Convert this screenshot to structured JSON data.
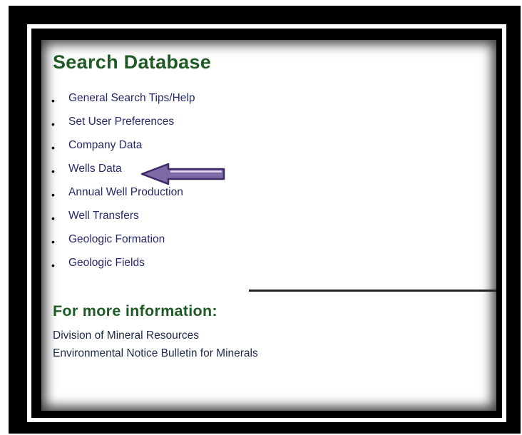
{
  "colors": {
    "heading": "#1e5b24",
    "link": "#26296a",
    "info_link": "#1f2a4a",
    "arrow_fill": "#7e6aa6",
    "arrow_stroke": "#3c2a66",
    "divider": "#222222"
  },
  "search": {
    "title": "Search Database",
    "items": [
      {
        "label": "General Search Tips/Help"
      },
      {
        "label": "Set User Preferences"
      },
      {
        "label": "Company Data"
      },
      {
        "label": "Wells Data"
      },
      {
        "label": "Annual Well Production"
      },
      {
        "label": "Well Transfers"
      },
      {
        "label": "Geologic Formation"
      },
      {
        "label": "Geologic Fields"
      }
    ],
    "bullet_glyph": "•"
  },
  "annotation": {
    "icon": "left-arrow-icon",
    "points_to": "Wells Data"
  },
  "more_info": {
    "title": "For more information:",
    "links": [
      {
        "label": "Division of Mineral Resources"
      },
      {
        "label": "Environmental Notice Bulletin for Minerals"
      }
    ]
  }
}
